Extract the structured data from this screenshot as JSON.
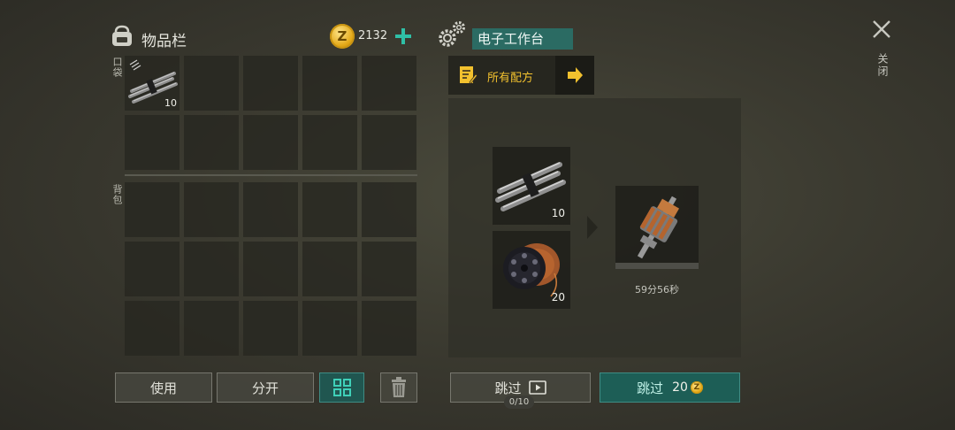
{
  "inventory": {
    "title": "物品栏",
    "coins": "2132",
    "pouch_label": "口袋",
    "bag_label": "背包",
    "pouch_item_qty": "10"
  },
  "workbench": {
    "title": "电子工作台",
    "all_recipes_label": "所有配方",
    "ingredient1_qty": "10",
    "ingredient2_qty": "20",
    "time_remaining": "59分56秒"
  },
  "buttons": {
    "use": "使用",
    "split": "分开",
    "skip_ad": "跳过",
    "skip_ad_count": "0/10",
    "skip_coins": "跳过",
    "skip_cost": "20"
  },
  "close": {
    "label": "关闭"
  },
  "colors": {
    "accent_teal": "#205650",
    "recipe_yellow": "#f2c12e",
    "coin_gold": "#e3a817"
  }
}
